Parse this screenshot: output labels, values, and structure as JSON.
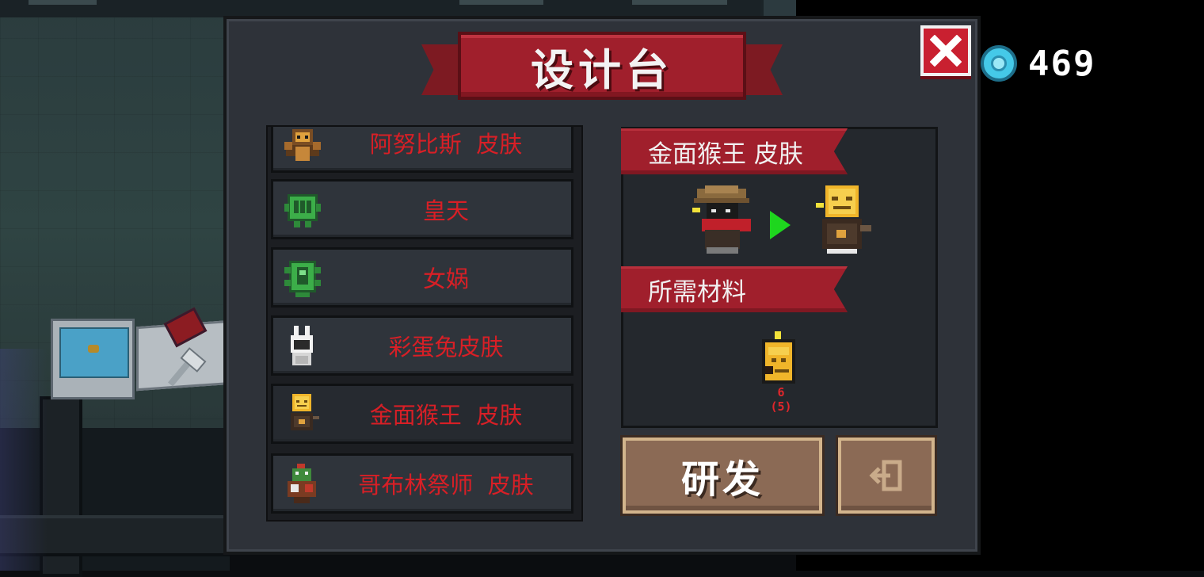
{
  "title": "设计台",
  "gems": "469",
  "skin_list": [
    {
      "label": "阿努比斯  皮肤",
      "icon": "anubis-skin-icon"
    },
    {
      "label": "皇天",
      "icon": "green-robot-icon"
    },
    {
      "label": "女娲",
      "icon": "green-serpent-icon"
    },
    {
      "label": "彩蛋兔皮肤",
      "icon": "easter-bunny-icon"
    },
    {
      "label": "金面猴王  皮肤",
      "icon": "golden-monkey-king-icon"
    },
    {
      "label": "哥布林祭师  皮肤",
      "icon": "goblin-priest-icon"
    }
  ],
  "detail": {
    "selected_name": "金面猴王  皮肤",
    "materials_header": "所需材料",
    "material_owned": "6",
    "material_required": "(5)"
  },
  "buttons": {
    "craft": "研发"
  },
  "colors": {
    "panel": "#2e3239",
    "ribbon_red": "#a01f2c",
    "item_text_red": "#d81f26",
    "button_brown": "#8b6a55",
    "gem_cyan": "#45c9e8",
    "arrow_green": "#1ed61e"
  }
}
